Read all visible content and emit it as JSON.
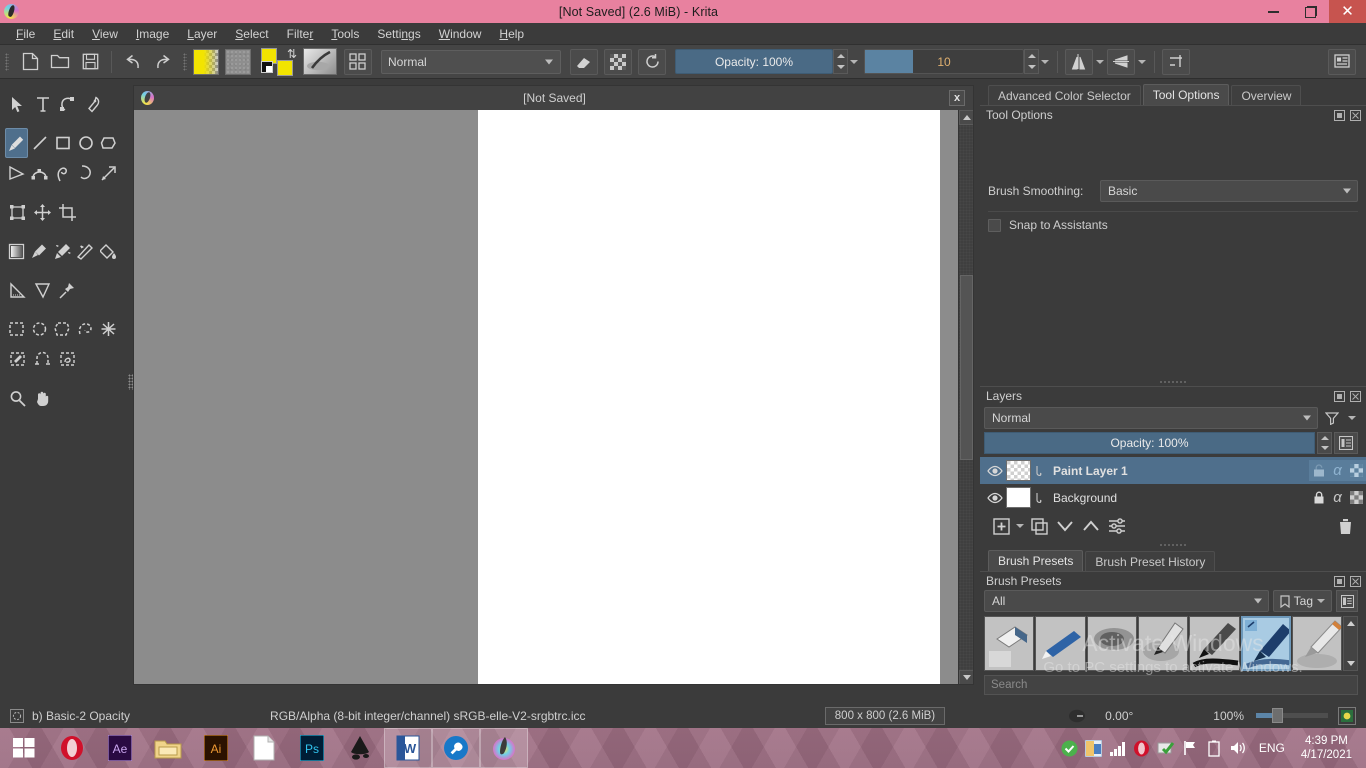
{
  "titlebar": {
    "title": "[Not Saved]  (2.6 MiB)  - Krita",
    "app_icon": "krita-logo-icon",
    "minimize": "minimize-icon",
    "maximize": "restore-icon",
    "close": "✕"
  },
  "menubar": {
    "items": [
      {
        "label": "File",
        "accel": "F"
      },
      {
        "label": "Edit",
        "accel": "E"
      },
      {
        "label": "View",
        "accel": "V"
      },
      {
        "label": "Image",
        "accel": "I"
      },
      {
        "label": "Layer",
        "accel": "L"
      },
      {
        "label": "Select",
        "accel": "S"
      },
      {
        "label": "Filter",
        "accel": "r"
      },
      {
        "label": "Tools",
        "accel": "T"
      },
      {
        "label": "Settings",
        "accel": "n"
      },
      {
        "label": "Window",
        "accel": "W"
      },
      {
        "label": "Help",
        "accel": "H"
      }
    ]
  },
  "toolbar": {
    "new_label": "new-file",
    "open_label": "open-file",
    "save_label": "save-file",
    "undo_label": "undo",
    "redo_label": "redo",
    "gradient_swatch": "gradient",
    "pattern_swatch": "pattern",
    "foreground_color": "#f2e400",
    "background_color": "#f2e400",
    "blend_mode": "Normal",
    "eraser_label": "eraser-mode",
    "alpha_label": "preserve-alpha",
    "reload_label": "reload-preset",
    "opacity_label": "Opacity: 100%",
    "opacity_value": "100%",
    "size_value": "10",
    "mirror_h": "mirror-horizontal",
    "mirror_v": "mirror-vertical",
    "wraparound": "wraparound-mode",
    "workspace": "workspace-chooser"
  },
  "toolbox": {
    "rows": [
      [
        "select-shapes-tool",
        "text-tool",
        "edit-shapes-tool",
        "calligraphy-tool"
      ],
      [
        "freehand-brush-tool",
        "line-tool",
        "rectangle-tool",
        "ellipse-tool",
        "polygon-tool"
      ],
      [
        "polyline-tool",
        "bezier-curve-tool",
        "freehand-path-tool",
        "dynamic-brush-tool",
        "multibrush-tool"
      ],
      [
        "transform-tool",
        "move-tool",
        "crop-tool"
      ],
      [
        "gradient-tool",
        "color-sampler-tool",
        "colorize-mask-tool",
        "smart-patch-tool",
        "fill-tool"
      ],
      [
        "measure-tool",
        "perspective-grid-tool",
        "assistant-tool"
      ],
      [
        "rectangular-selection-tool",
        "elliptical-selection-tool",
        "polygonal-selection-tool",
        "freehand-selection-tool",
        "contiguous-selection-tool"
      ],
      [
        "bezier-selection-tool",
        "magnetic-selection-tool",
        "similar-color-selection-tool"
      ],
      [
        "zoom-tool",
        "pan-tool"
      ]
    ],
    "active_tool": "freehand-brush-tool"
  },
  "canvas": {
    "subwindow_title": "[Not Saved]",
    "close_label": "x",
    "document_size": "800 x 800"
  },
  "dockers": {
    "tabs": [
      {
        "label": "Advanced Color Selector",
        "active": false
      },
      {
        "label": "Tool Options",
        "active": true
      },
      {
        "label": "Overview",
        "active": false
      }
    ],
    "tool_options": {
      "title": "Tool Options",
      "brush_smoothing_label": "Brush Smoothing:",
      "brush_smoothing_value": "Basic",
      "snap_label": "Snap to Assistants",
      "snap_checked": false
    },
    "layers": {
      "title": "Layers",
      "blend_mode": "Normal",
      "opacity_label": "Opacity:  100%",
      "opacity_value": "100%",
      "filter_icon": "filter-icon",
      "properties_icon": "layer-properties-icon",
      "rows": [
        {
          "name": "Paint Layer 1",
          "selected": true,
          "thumb": "checker",
          "visible": true,
          "lock": "unlocked",
          "alpha": "α",
          "inherit": "inherit-alpha"
        },
        {
          "name": "Background",
          "selected": false,
          "thumb": "white",
          "visible": true,
          "lock": "locked",
          "alpha": "α",
          "inherit": "inherit-alpha"
        }
      ],
      "toolbar": [
        "add-layer-button",
        "duplicate-layer-button",
        "move-layer-down-button",
        "move-layer-up-button",
        "layer-properties-button",
        "delete-layer-button"
      ]
    },
    "brush_presets": {
      "tabs": [
        {
          "label": "Brush Presets",
          "active": true
        },
        {
          "label": "Brush Preset History",
          "active": false
        }
      ],
      "title": "Brush Presets",
      "filter_value": "All",
      "tag_label": "Tag",
      "search_placeholder": "Search",
      "presets": [
        {
          "name": "eraser-soft-preset",
          "active": false
        },
        {
          "name": "ink-ballpen-preset",
          "active": false
        },
        {
          "name": "airbrush-soft-preset",
          "active": false
        },
        {
          "name": "ink-gpen-preset",
          "active": false
        },
        {
          "name": "ink-pen-preset",
          "active": false
        },
        {
          "name": "basic-2-opacity-preset",
          "active": true
        },
        {
          "name": "pencil-preset",
          "active": false
        }
      ]
    }
  },
  "statusbar": {
    "brush_preset": "b) Basic-2 Opacity",
    "color_info": "RGB/Alpha (8-bit integer/channel)  sRGB-elle-V2-srgbtrc.icc",
    "dimensions": "800 x 800 (2.6 MiB)",
    "rotation": "0.00°",
    "zoom": "100%",
    "selection_icon": "selection-mask-icon",
    "brush_cursor_icon": "brush-size-icon"
  },
  "watermark": {
    "line1": "Activate Windows",
    "line2": "Go to PC settings to activate Windows."
  },
  "taskbar": {
    "start": "windows-start-icon",
    "apps": [
      {
        "name": "opera-icon",
        "running": false
      },
      {
        "name": "after-effects-icon",
        "running": false
      },
      {
        "name": "file-explorer-icon",
        "running": false
      },
      {
        "name": "illustrator-icon",
        "running": false
      },
      {
        "name": "document-icon",
        "running": false
      },
      {
        "name": "photoshop-icon",
        "running": false
      },
      {
        "name": "inkscape-icon",
        "running": false
      },
      {
        "name": "word-icon",
        "running": true
      },
      {
        "name": "tool-wrench-icon",
        "running": true
      },
      {
        "name": "krita-icon",
        "running": true
      }
    ],
    "tray": [
      "security-ok-icon",
      "office-uploader-icon",
      "network-signal-icon",
      "opera-tray-icon",
      "check-shield-icon",
      "flag-icon",
      "battery-icon",
      "volume-icon"
    ],
    "language": "ENG",
    "time": "4:39 PM",
    "date": "4/17/2021"
  }
}
